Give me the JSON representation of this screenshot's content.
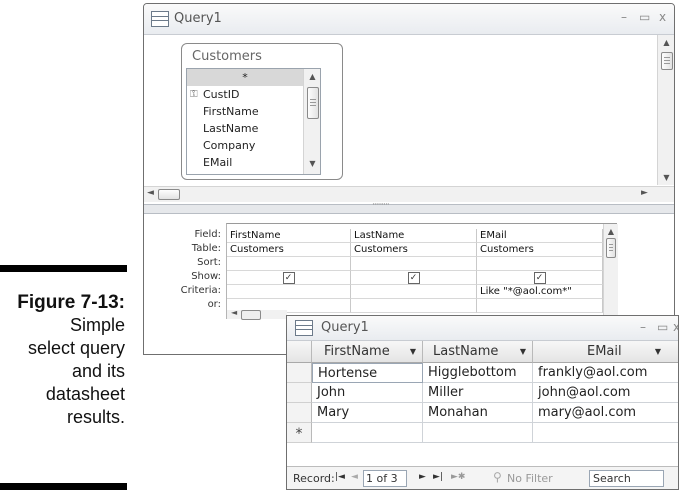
{
  "caption": {
    "figure": "Figure 7-13:",
    "lines": [
      "Simple",
      "select query",
      "and its",
      "datasheet",
      "results."
    ]
  },
  "query_window": {
    "title": "Query1",
    "controls": {
      "minimize": "–",
      "restore": "▭",
      "close": "x"
    },
    "table": {
      "name": "Customers",
      "fields": [
        "*",
        "CustID",
        "FirstName",
        "LastName",
        "Company",
        "EMail"
      ],
      "key_field": "CustID",
      "selected": "*"
    },
    "grid": {
      "row_labels": [
        "Field:",
        "Table:",
        "Sort:",
        "Show:",
        "Criteria:",
        "or:"
      ],
      "columns": [
        {
          "field": "FirstName",
          "table": "Customers",
          "sort": "",
          "show": true,
          "criteria": "",
          "or": ""
        },
        {
          "field": "LastName",
          "table": "Customers",
          "sort": "",
          "show": true,
          "criteria": "",
          "or": ""
        },
        {
          "field": "EMail",
          "table": "Customers",
          "sort": "",
          "show": true,
          "criteria": "Like \"*@aol.com*\"",
          "or": ""
        }
      ]
    }
  },
  "datasheet": {
    "title": "Query1",
    "controls": {
      "minimize": "–",
      "restore": "▭",
      "close": "x"
    },
    "columns": [
      "FirstName",
      "LastName",
      "EMail"
    ],
    "rows": [
      [
        "Hortense",
        "Higglebottom",
        "frankly@aol.com"
      ],
      [
        "John",
        "Miller",
        "john@aol.com"
      ],
      [
        "Mary",
        "Monahan",
        "mary@aol.com"
      ]
    ],
    "new_row_marker": "*",
    "nav": {
      "label": "Record:",
      "first": "|◄",
      "prev": "◄",
      "position": "1 of 3",
      "next": "►",
      "last": "►|",
      "new": "►✱",
      "filter": "No Filter",
      "search": "Search"
    }
  },
  "colors": {
    "window_border": "#6f6f6f",
    "selection": "#d8d8d8",
    "grid_line": "#cfd3d8"
  }
}
